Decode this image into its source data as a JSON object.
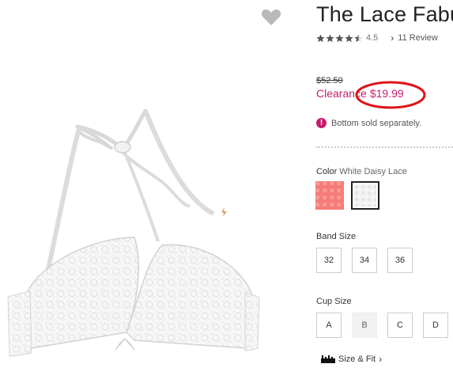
{
  "product": {
    "title": "The Lace Fabul",
    "rating_value": "4.5",
    "rating_stars": 4.5,
    "reviews_label": "11 Review",
    "old_price": "$52.50",
    "clearance_label": "Clearance",
    "clearance_price": "$19.99",
    "notice": "Bottom sold separately.",
    "notice_icon": "exclamation-icon"
  },
  "colors": {
    "accent": "#c81d6f",
    "annotation_circle": "#e0121a"
  },
  "color_option": {
    "label": "Color",
    "selected": "White Daisy Lace",
    "swatches": [
      {
        "name": "coral",
        "color": "#f57c78",
        "selected": false
      },
      {
        "name": "white-daisy-lace",
        "color": "#f4f4f4",
        "selected": true
      }
    ]
  },
  "band_size": {
    "label": "Band Size",
    "options": [
      "32",
      "34",
      "36"
    ]
  },
  "cup_size": {
    "label": "Cup Size",
    "options": [
      {
        "label": "A",
        "available": true
      },
      {
        "label": "B",
        "available": false
      },
      {
        "label": "C",
        "available": true
      },
      {
        "label": "D",
        "available": true
      }
    ]
  },
  "size_fit": {
    "label": "Size & Fit",
    "icon": "ruler-icon"
  },
  "wishlist_icon": "heart-icon",
  "image_alt": "white lace bra product image"
}
